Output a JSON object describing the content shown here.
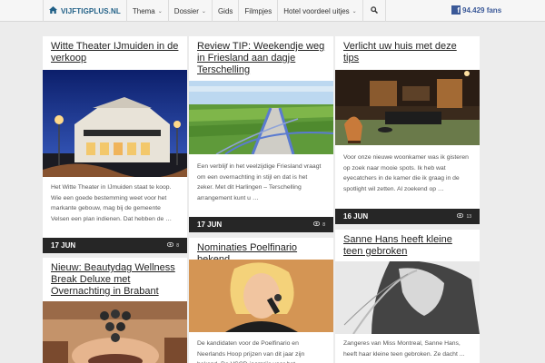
{
  "nav": {
    "brand": "VIJFTIGPLUS.NL",
    "items": [
      {
        "label": "Thema",
        "dropdown": true
      },
      {
        "label": "Dossier",
        "dropdown": true
      },
      {
        "label": "Gids",
        "dropdown": false
      },
      {
        "label": "Filmpjes",
        "dropdown": false
      },
      {
        "label": "Hotel voordeel uitjes",
        "dropdown": true
      }
    ],
    "facebook_fans": "94.429 fans"
  },
  "cards": [
    {
      "title": "Witte Theater IJmuiden in de verkoop",
      "excerpt": "Het Witte Theater in IJmuiden staat te koop.  Wie een goede bestemming weet voor het markante gebouw, mag bij de gemeente Velsen een plan indienen. Dat hebben de …",
      "date": "17 JUN",
      "views": "8"
    },
    {
      "title": "Review TIP: Weekendje weg in Friesland aan dagje Terschelling",
      "excerpt": "Een verblijf in het veelzijdige Friesland vraagt om een overnachting in stijl en dat is het zeker. Met dit Harlingen – Terschelling arrangement kunt u …",
      "date": "17 JUN",
      "views": "8"
    },
    {
      "title": "Verlicht uw huis met deze tips",
      "excerpt": "Voor onze nieuwe woonkamer was ik gisteren op zoek naar mooie spots. Ik heb wat eyecatchers in de kamer die ik graag in de spotlight wil zetten. Al zoekend op …",
      "date": "16 JUN",
      "views": "13"
    },
    {
      "title": "Nieuw: Beautydag Wellness Break Deluxe met Overnachting in Brabant"
    },
    {
      "title": "Nominaties Poelfinario bekend",
      "excerpt": "De kandidaten voor de Poelfinario en Neerlands Hoop prijzen van dit jaar zijn bekend. De VSCD-jaarprijs voor het ..."
    },
    {
      "title": "Sanne Hans heeft kleine teen gebroken",
      "excerpt": "Zangeres van Miss Montreal, Sanne Hans, heeft haar kleine teen gebroken. Ze dacht ..."
    }
  ]
}
